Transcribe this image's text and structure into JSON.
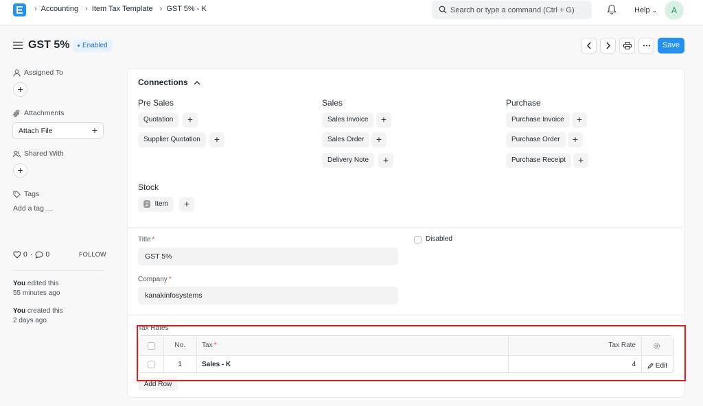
{
  "navbar": {
    "breadcrumbs": [
      "Accounting",
      "Item Tax Template",
      "GST 5% - K"
    ],
    "search_placeholder": "Search or type a command (Ctrl + G)",
    "help_label": "Help",
    "avatar_initial": "A"
  },
  "page": {
    "title": "GST 5%",
    "status": "Enabled",
    "save_label": "Save"
  },
  "sidebar": {
    "assigned_to": "Assigned To",
    "attachments": "Attachments",
    "attach_file": "Attach File",
    "shared_with": "Shared With",
    "tags": "Tags",
    "add_tag": "Add a tag ...",
    "likes": "0",
    "comments": "0",
    "follow": "FOLLOW",
    "activity": [
      {
        "who": "You",
        "action": " edited this",
        "when": "55 minutes ago"
      },
      {
        "who": "You",
        "action": " created this",
        "when": "2 days ago"
      }
    ]
  },
  "connections": {
    "heading": "Connections",
    "groups": {
      "pre_sales": {
        "title": "Pre Sales",
        "items": [
          "Quotation",
          "Supplier Quotation"
        ]
      },
      "sales": {
        "title": "Sales",
        "items": [
          "Sales Invoice",
          "Sales Order",
          "Delivery Note"
        ]
      },
      "purchase": {
        "title": "Purchase",
        "items": [
          "Purchase Invoice",
          "Purchase Order",
          "Purchase Receipt"
        ]
      },
      "stock": {
        "title": "Stock",
        "items": [
          {
            "label": "Item",
            "count": "2"
          }
        ]
      }
    }
  },
  "form": {
    "title_label": "Title",
    "title_value": "GST 5%",
    "company_label": "Company",
    "company_value": "kanakinfosystems",
    "disabled_label": "Disabled"
  },
  "tax_rates": {
    "label": "Tax Rates",
    "columns": {
      "no": "No.",
      "tax": "Tax",
      "rate": "Tax Rate"
    },
    "rows": [
      {
        "no": "1",
        "tax": "Sales - K",
        "rate": "4",
        "edit": "Edit"
      }
    ],
    "add_row": "Add Row"
  }
}
